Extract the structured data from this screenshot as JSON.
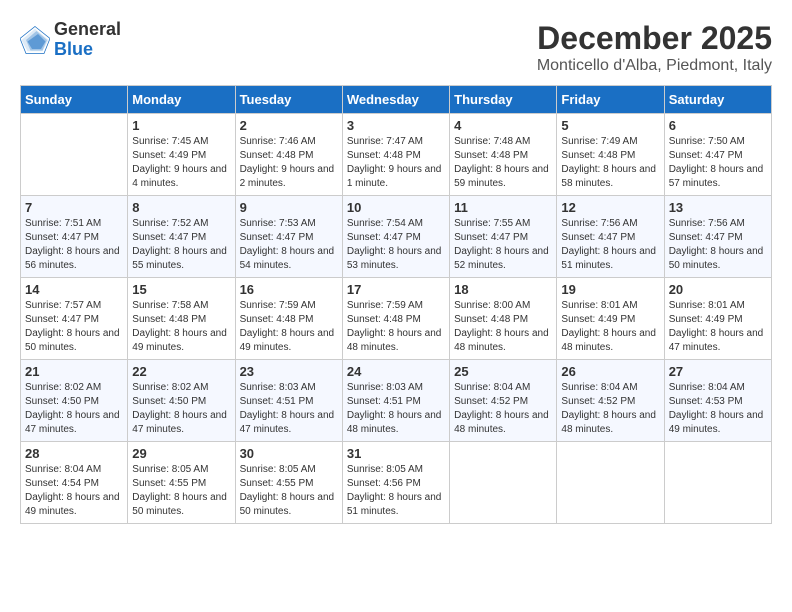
{
  "logo": {
    "general": "General",
    "blue": "Blue"
  },
  "title": "December 2025",
  "location": "Monticello d'Alba, Piedmont, Italy",
  "days_of_week": [
    "Sunday",
    "Monday",
    "Tuesday",
    "Wednesday",
    "Thursday",
    "Friday",
    "Saturday"
  ],
  "weeks": [
    [
      {
        "day": "",
        "sunrise": "",
        "sunset": "",
        "daylight": ""
      },
      {
        "day": "1",
        "sunrise": "Sunrise: 7:45 AM",
        "sunset": "Sunset: 4:49 PM",
        "daylight": "Daylight: 9 hours and 4 minutes."
      },
      {
        "day": "2",
        "sunrise": "Sunrise: 7:46 AM",
        "sunset": "Sunset: 4:48 PM",
        "daylight": "Daylight: 9 hours and 2 minutes."
      },
      {
        "day": "3",
        "sunrise": "Sunrise: 7:47 AM",
        "sunset": "Sunset: 4:48 PM",
        "daylight": "Daylight: 9 hours and 1 minute."
      },
      {
        "day": "4",
        "sunrise": "Sunrise: 7:48 AM",
        "sunset": "Sunset: 4:48 PM",
        "daylight": "Daylight: 8 hours and 59 minutes."
      },
      {
        "day": "5",
        "sunrise": "Sunrise: 7:49 AM",
        "sunset": "Sunset: 4:48 PM",
        "daylight": "Daylight: 8 hours and 58 minutes."
      },
      {
        "day": "6",
        "sunrise": "Sunrise: 7:50 AM",
        "sunset": "Sunset: 4:47 PM",
        "daylight": "Daylight: 8 hours and 57 minutes."
      }
    ],
    [
      {
        "day": "7",
        "sunrise": "Sunrise: 7:51 AM",
        "sunset": "Sunset: 4:47 PM",
        "daylight": "Daylight: 8 hours and 56 minutes."
      },
      {
        "day": "8",
        "sunrise": "Sunrise: 7:52 AM",
        "sunset": "Sunset: 4:47 PM",
        "daylight": "Daylight: 8 hours and 55 minutes."
      },
      {
        "day": "9",
        "sunrise": "Sunrise: 7:53 AM",
        "sunset": "Sunset: 4:47 PM",
        "daylight": "Daylight: 8 hours and 54 minutes."
      },
      {
        "day": "10",
        "sunrise": "Sunrise: 7:54 AM",
        "sunset": "Sunset: 4:47 PM",
        "daylight": "Daylight: 8 hours and 53 minutes."
      },
      {
        "day": "11",
        "sunrise": "Sunrise: 7:55 AM",
        "sunset": "Sunset: 4:47 PM",
        "daylight": "Daylight: 8 hours and 52 minutes."
      },
      {
        "day": "12",
        "sunrise": "Sunrise: 7:56 AM",
        "sunset": "Sunset: 4:47 PM",
        "daylight": "Daylight: 8 hours and 51 minutes."
      },
      {
        "day": "13",
        "sunrise": "Sunrise: 7:56 AM",
        "sunset": "Sunset: 4:47 PM",
        "daylight": "Daylight: 8 hours and 50 minutes."
      }
    ],
    [
      {
        "day": "14",
        "sunrise": "Sunrise: 7:57 AM",
        "sunset": "Sunset: 4:47 PM",
        "daylight": "Daylight: 8 hours and 50 minutes."
      },
      {
        "day": "15",
        "sunrise": "Sunrise: 7:58 AM",
        "sunset": "Sunset: 4:48 PM",
        "daylight": "Daylight: 8 hours and 49 minutes."
      },
      {
        "day": "16",
        "sunrise": "Sunrise: 7:59 AM",
        "sunset": "Sunset: 4:48 PM",
        "daylight": "Daylight: 8 hours and 49 minutes."
      },
      {
        "day": "17",
        "sunrise": "Sunrise: 7:59 AM",
        "sunset": "Sunset: 4:48 PM",
        "daylight": "Daylight: 8 hours and 48 minutes."
      },
      {
        "day": "18",
        "sunrise": "Sunrise: 8:00 AM",
        "sunset": "Sunset: 4:48 PM",
        "daylight": "Daylight: 8 hours and 48 minutes."
      },
      {
        "day": "19",
        "sunrise": "Sunrise: 8:01 AM",
        "sunset": "Sunset: 4:49 PM",
        "daylight": "Daylight: 8 hours and 48 minutes."
      },
      {
        "day": "20",
        "sunrise": "Sunrise: 8:01 AM",
        "sunset": "Sunset: 4:49 PM",
        "daylight": "Daylight: 8 hours and 47 minutes."
      }
    ],
    [
      {
        "day": "21",
        "sunrise": "Sunrise: 8:02 AM",
        "sunset": "Sunset: 4:50 PM",
        "daylight": "Daylight: 8 hours and 47 minutes."
      },
      {
        "day": "22",
        "sunrise": "Sunrise: 8:02 AM",
        "sunset": "Sunset: 4:50 PM",
        "daylight": "Daylight: 8 hours and 47 minutes."
      },
      {
        "day": "23",
        "sunrise": "Sunrise: 8:03 AM",
        "sunset": "Sunset: 4:51 PM",
        "daylight": "Daylight: 8 hours and 47 minutes."
      },
      {
        "day": "24",
        "sunrise": "Sunrise: 8:03 AM",
        "sunset": "Sunset: 4:51 PM",
        "daylight": "Daylight: 8 hours and 48 minutes."
      },
      {
        "day": "25",
        "sunrise": "Sunrise: 8:04 AM",
        "sunset": "Sunset: 4:52 PM",
        "daylight": "Daylight: 8 hours and 48 minutes."
      },
      {
        "day": "26",
        "sunrise": "Sunrise: 8:04 AM",
        "sunset": "Sunset: 4:52 PM",
        "daylight": "Daylight: 8 hours and 48 minutes."
      },
      {
        "day": "27",
        "sunrise": "Sunrise: 8:04 AM",
        "sunset": "Sunset: 4:53 PM",
        "daylight": "Daylight: 8 hours and 49 minutes."
      }
    ],
    [
      {
        "day": "28",
        "sunrise": "Sunrise: 8:04 AM",
        "sunset": "Sunset: 4:54 PM",
        "daylight": "Daylight: 8 hours and 49 minutes."
      },
      {
        "day": "29",
        "sunrise": "Sunrise: 8:05 AM",
        "sunset": "Sunset: 4:55 PM",
        "daylight": "Daylight: 8 hours and 50 minutes."
      },
      {
        "day": "30",
        "sunrise": "Sunrise: 8:05 AM",
        "sunset": "Sunset: 4:55 PM",
        "daylight": "Daylight: 8 hours and 50 minutes."
      },
      {
        "day": "31",
        "sunrise": "Sunrise: 8:05 AM",
        "sunset": "Sunset: 4:56 PM",
        "daylight": "Daylight: 8 hours and 51 minutes."
      },
      {
        "day": "",
        "sunrise": "",
        "sunset": "",
        "daylight": ""
      },
      {
        "day": "",
        "sunrise": "",
        "sunset": "",
        "daylight": ""
      },
      {
        "day": "",
        "sunrise": "",
        "sunset": "",
        "daylight": ""
      }
    ]
  ]
}
